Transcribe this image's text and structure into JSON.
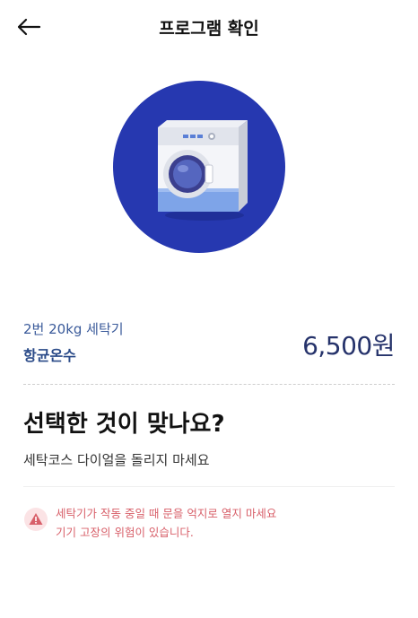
{
  "header": {
    "title": "프로그램 확인",
    "back_icon": "arrow-left-icon"
  },
  "hero": {
    "icon": "washing-machine-icon",
    "circle_color": "#2638b0"
  },
  "selection": {
    "machine": "2번 20kg 세탁기",
    "course": "항균온수",
    "price": "6,500원"
  },
  "confirm": {
    "question": "선택한 것이 맞나요?",
    "instruction": "세탁코스 다이얼을 돌리지 마세요"
  },
  "warning": {
    "icon": "warning-triangle-icon",
    "line1": "세탁기가 작동 중일 때 문을 억지로 열지 마세요",
    "line2": "기기 고장의 위험이 있습니다.",
    "color": "#d8606a"
  }
}
